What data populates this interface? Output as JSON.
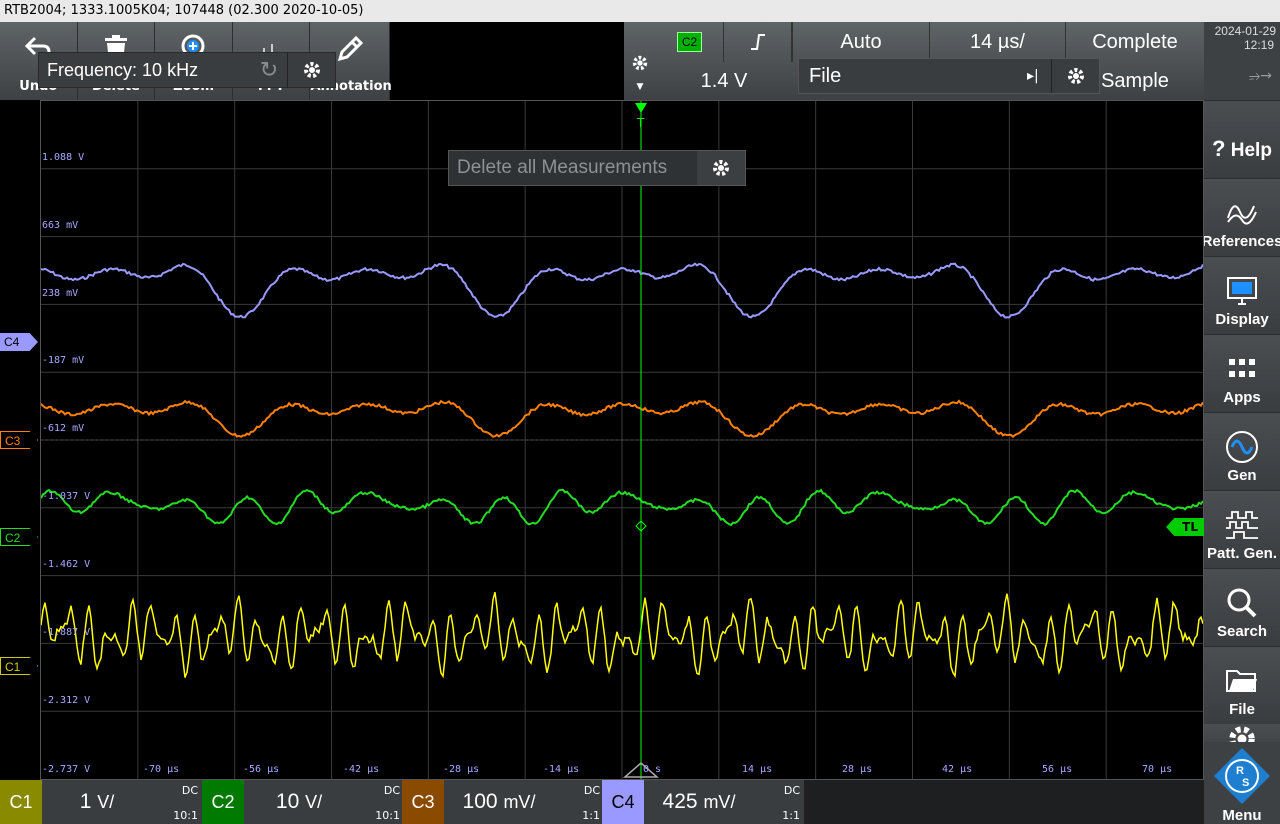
{
  "title": "RTB2004; 1333.1005K04; 107448 (02.300 2020-10-05)",
  "toolbar": {
    "items": [
      {
        "label": "Undo",
        "icon": "undo-icon"
      },
      {
        "label": "Delete",
        "icon": "trash-icon"
      },
      {
        "label": "Zoom",
        "icon": "zoom-icon"
      },
      {
        "label": "FFT",
        "icon": "fft-icon"
      },
      {
        "label": "Annotation",
        "icon": "pen-icon"
      }
    ]
  },
  "freq_popup": {
    "text": "Frequency: 10 kHz"
  },
  "trigger": {
    "source": "C2",
    "slope_icon": "rising-edge-icon",
    "level": "1.4 V",
    "mode": "Auto",
    "timebase": "14 µs/",
    "acq_state": "Complete",
    "file_label": "File",
    "acq_mode": "Sample"
  },
  "datetime": {
    "date": "2024-01-29",
    "time": "12:19"
  },
  "right_panel": [
    {
      "label": "Help",
      "icon": "help-icon"
    },
    {
      "label": "References",
      "icon": "references-icon"
    },
    {
      "label": "Display",
      "icon": "display-icon"
    },
    {
      "label": "Apps",
      "icon": "apps-icon"
    },
    {
      "label": "Gen",
      "icon": "generator-icon"
    },
    {
      "label": "Patt. Gen.",
      "icon": "pattern-generator-icon"
    },
    {
      "label": "Search",
      "icon": "search-icon"
    },
    {
      "label": "File",
      "icon": "folder-icon"
    },
    {
      "label": "Menu",
      "icon": "rs-logo-icon"
    }
  ],
  "measure_popup": {
    "text": "Delete all Measurements"
  },
  "y_labels": [
    "1.088 V",
    "663 mV",
    "238 mV",
    "-187 mV",
    "-612 mV",
    "-1.037 V",
    "-1.462 V",
    "-1.887 V",
    "-2.312 V",
    "-2.737 V"
  ],
  "x_labels": [
    "-70 µs",
    "-56 µs",
    "-42 µs",
    "-28 µs",
    "-14 µs",
    "0 s",
    "14 µs",
    "28 µs",
    "42 µs",
    "56 µs",
    "70 µs"
  ],
  "markers": {
    "c4": "C4",
    "c3": "C3",
    "c2": "C2",
    "c1": "C1",
    "tl": "TL"
  },
  "channels": [
    {
      "name": "C1",
      "scale_num": "1",
      "scale_unit": "V/",
      "coupling": "DC",
      "probe": "10:1",
      "color": "#e6e600"
    },
    {
      "name": "C2",
      "scale_num": "10",
      "scale_unit": "V/",
      "coupling": "DC",
      "probe": "10:1",
      "color": "#00c000"
    },
    {
      "name": "C3",
      "scale_num": "100",
      "scale_unit": "mV/",
      "coupling": "DC",
      "probe": "1:1",
      "color": "#ff7f00"
    },
    {
      "name": "C4",
      "scale_num": "425",
      "scale_unit": "mV/",
      "coupling": "DC",
      "probe": "1:1",
      "color": "#9a9aff"
    }
  ],
  "colors": {
    "c1": "#ffff00",
    "c2": "#22dd22",
    "c3": "#ff8000",
    "c4": "#9999ff",
    "grid": "#3a3a3a",
    "trigger": "#00ff00"
  }
}
